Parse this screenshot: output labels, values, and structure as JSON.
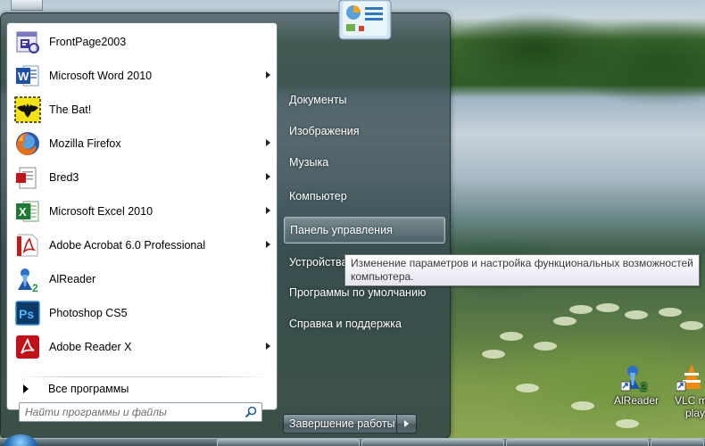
{
  "start_menu": {
    "pinned_programs": [
      {
        "label": "FrontPage2003",
        "icon": "frontpage-icon",
        "has_submenu": false
      },
      {
        "label": "Microsoft Word 2010",
        "icon": "word-icon",
        "has_submenu": true
      },
      {
        "label": "The Bat!",
        "icon": "thebat-icon",
        "has_submenu": false
      },
      {
        "label": "Mozilla Firefox",
        "icon": "firefox-icon",
        "has_submenu": true
      },
      {
        "label": "Bred3",
        "icon": "bred3-icon",
        "has_submenu": true
      },
      {
        "label": "Microsoft Excel 2010",
        "icon": "excel-icon",
        "has_submenu": true
      },
      {
        "label": "Adobe Acrobat 6.0 Professional",
        "icon": "acrobat-icon",
        "has_submenu": true
      },
      {
        "label": "AlReader",
        "icon": "alreader-icon",
        "has_submenu": false
      },
      {
        "label": "Photoshop CS5",
        "icon": "photoshop-icon",
        "has_submenu": false
      },
      {
        "label": "Adobe Reader X",
        "icon": "adobe-reader-icon",
        "has_submenu": true
      }
    ],
    "all_programs_label": "Все программы",
    "search": {
      "placeholder": "Найти программы и файлы",
      "value": ""
    },
    "right_links": [
      {
        "label": "Документы",
        "hovered": false
      },
      {
        "label": "Изображения",
        "hovered": false
      },
      {
        "label": "Музыка",
        "hovered": false
      },
      {
        "label": "Компьютер",
        "hovered": false
      },
      {
        "label": "Панель управления",
        "hovered": true
      },
      {
        "label": "Устройства",
        "hovered": false
      },
      {
        "label": "Программы по умолчанию",
        "hovered": false
      },
      {
        "label": "Справка и поддержка",
        "hovered": false
      }
    ],
    "shutdown_label": "Завершение работы",
    "tooltip_line1": "Изменение параметров и настройка функциональных возможностей",
    "tooltip_line2": "компьютера."
  },
  "desktop_icons": [
    {
      "label": "AlReader",
      "icon": "alreader-shortcut-icon"
    },
    {
      "label_line1": "VLC m",
      "label_line2": "play",
      "icon": "vlc-shortcut-icon"
    }
  ],
  "colors": {
    "menu_glass": "#4a5f66",
    "left_panel_bg": "#ffffff",
    "tooltip_text": "#3b3b3b",
    "link_text": "#ffffff"
  }
}
